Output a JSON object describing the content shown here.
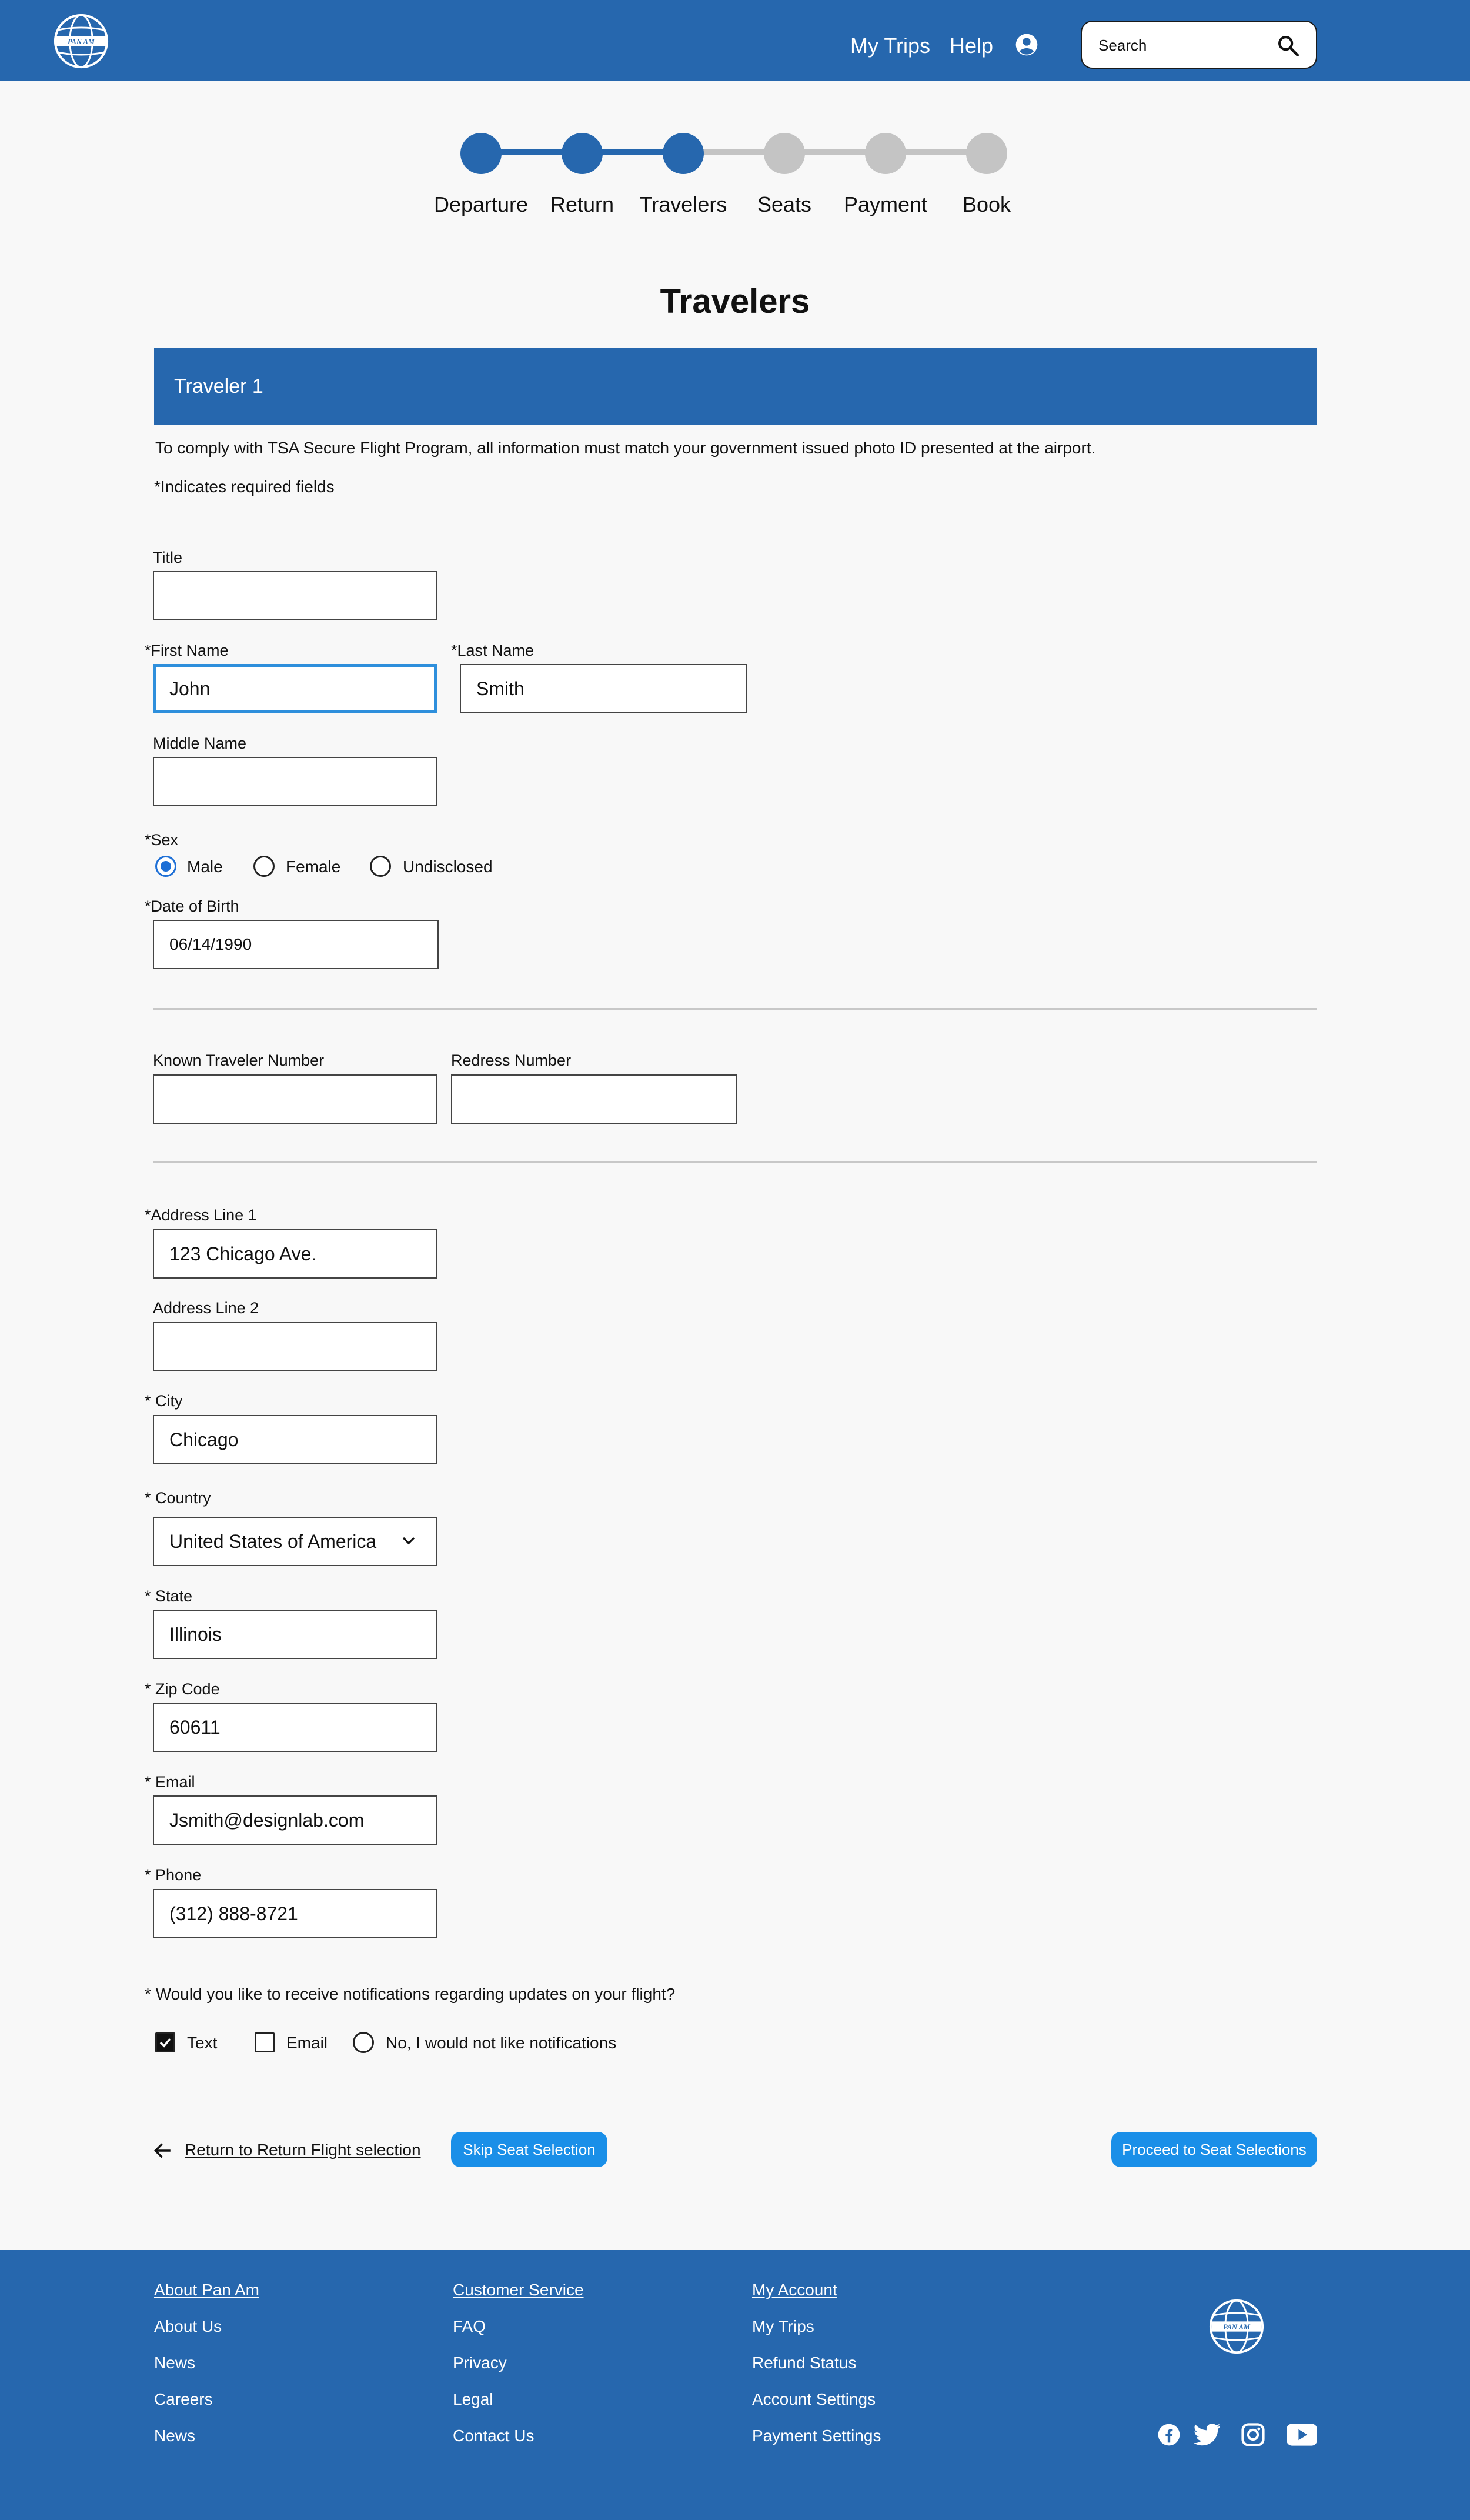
{
  "header": {
    "logo_text": "PAN AM",
    "nav": {
      "my_trips": "My Trips",
      "help": "Help"
    },
    "search": {
      "placeholder": "Search"
    }
  },
  "stepper": {
    "steps": [
      {
        "label": "Departure",
        "done": true
      },
      {
        "label": "Return",
        "done": true
      },
      {
        "label": "Travelers",
        "done": true
      },
      {
        "label": "Seats",
        "done": false
      },
      {
        "label": "Payment",
        "done": false
      },
      {
        "label": "Book",
        "done": false
      }
    ]
  },
  "page": {
    "title": "Travelers",
    "traveler_heading": "Traveler 1",
    "tsa_notice": "To comply with TSA Secure Flight Program, all information must match your government issued photo ID presented at the airport.",
    "required_note": "*Indicates required fields"
  },
  "form": {
    "title": {
      "label": "Title",
      "value": ""
    },
    "first_name": {
      "label": "First Name",
      "value": "John"
    },
    "last_name": {
      "label": "Last Name",
      "value": "Smith"
    },
    "middle_name": {
      "label": "Middle Name",
      "value": ""
    },
    "sex": {
      "label": "Sex",
      "options": [
        "Male",
        "Female",
        "Undisclosed"
      ],
      "selected": "Male"
    },
    "dob": {
      "label": "Date of Birth",
      "value": "06/14/1990"
    },
    "known_traveler": {
      "label": "Known Traveler Number",
      "value": ""
    },
    "redress": {
      "label": "Redress Number",
      "value": ""
    },
    "address1": {
      "label": "Address Line 1",
      "value": "123 Chicago Ave."
    },
    "address2": {
      "label": "Address Line 2",
      "value": ""
    },
    "city": {
      "label": "City",
      "value": "Chicago"
    },
    "country": {
      "label": "Country",
      "value": "United States of America"
    },
    "state": {
      "label": "State",
      "value": "Illinois"
    },
    "zip": {
      "label": "Zip Code",
      "value": "60611"
    },
    "email": {
      "label": "Email",
      "value": "Jsmith@designlab.com"
    },
    "phone": {
      "label": "Phone",
      "value": "(312) 888-8721"
    },
    "notifications": {
      "question": "Would you like to receive notifications regarding updates on your flight?",
      "text": "Text",
      "text_checked": true,
      "email": "Email",
      "email_checked": false,
      "none": "No, I would not like notifications",
      "none_selected": false
    },
    "required_marker": "*"
  },
  "actions": {
    "back": "Return to Return Flight selection",
    "skip": "Skip Seat Selection",
    "proceed": "Proceed to Seat Selections"
  },
  "footer": {
    "col1": [
      "About Pan Am",
      "About Us",
      "News",
      "Careers",
      "News"
    ],
    "col2": [
      "Customer Service",
      "FAQ",
      "Privacy",
      "Legal",
      "Contact Us"
    ],
    "col3": [
      "My Account",
      "My Trips",
      "Refund Status",
      "Account Settings",
      "Payment Settings"
    ],
    "logo_text": "PAN AM"
  },
  "colors": {
    "brand_blue": "#2667ae",
    "button_blue": "#1a8fe8",
    "step_inactive": "#c4c4c4",
    "focus_blue": "#2e8fdc"
  }
}
